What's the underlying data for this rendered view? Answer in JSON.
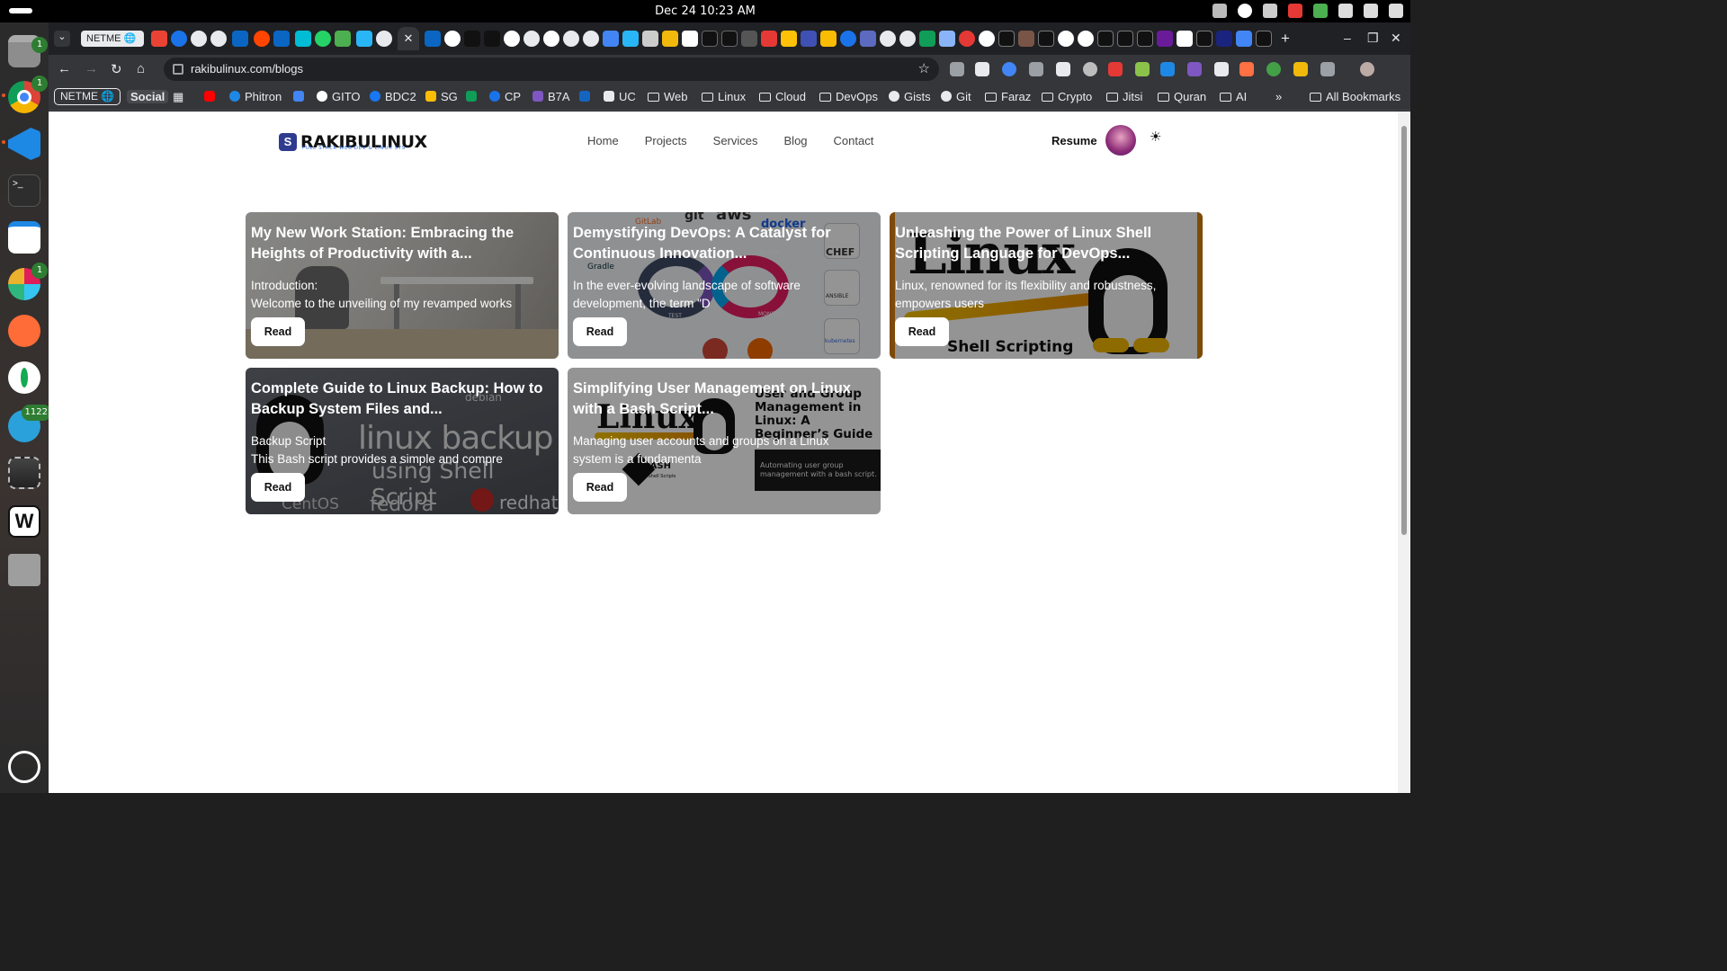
{
  "system": {
    "clock": "Dec 24  10:23 AM",
    "dock_badges": {
      "chrome_top": "1",
      "slack": "1",
      "telegram": "1122"
    }
  },
  "browser": {
    "tab_pill": "NETME 🌐",
    "url": "rakibulinux.com/blogs",
    "bookmarks": {
      "netme": "NETME 🌐",
      "items": [
        "Social",
        "Phitron",
        "GITO",
        "BDC2",
        "SG",
        "CP",
        "B7A",
        "UC",
        "Web",
        "Linux",
        "Cloud",
        "DevOps",
        "Gists",
        "Git",
        "Faraz",
        "Crypto",
        "Jitsi",
        "Quran",
        "AI"
      ],
      "all": "All Bookmarks"
    }
  },
  "site": {
    "logo_word": "RAKIBULINUX",
    "logo_sub": "FULL STACK WEB DEV & LINUX SYS",
    "nav": [
      "Home",
      "Projects",
      "Services",
      "Blog",
      "Contact"
    ],
    "resume": "Resume"
  },
  "posts": [
    {
      "title": "My New Work Station: Embracing the Heights of Productivity with a...",
      "excerpt_1": "Introduction:",
      "excerpt_2": "Welcome to the unveiling of my revamped works",
      "button": "Read"
    },
    {
      "title": "Demystifying DevOps: A Catalyst for Continuous Innovation...",
      "excerpt_1": "In the ever-evolving landscape of software",
      "excerpt_2": "development, the term \"D",
      "button": "Read"
    },
    {
      "title": "Unleashing the Power of Linux Shell Scripting Language for DevOps...",
      "excerpt_1": "Linux, renowned for its flexibility and robustness,",
      "excerpt_2": "empowers users",
      "button": "Read"
    },
    {
      "title": "Complete Guide to Linux Backup: How to Backup System Files and...",
      "excerpt_1": "Backup Script",
      "excerpt_2": "This Bash script provides a simple and compre",
      "button": "Read"
    },
    {
      "title": "Simplifying User Management on Linux with a Bash Script...",
      "excerpt_1": "Managing user accounts and groups on a Linux",
      "excerpt_2": "system is a fundamenta",
      "button": "Read"
    }
  ],
  "thumbnail_text": {
    "devops": [
      "git",
      "aws",
      "docker",
      "CHEF",
      "GitLab",
      "Gradle",
      "ANSIBLE",
      "kubernetes",
      "DEPLOY",
      "OPERATE",
      "MONITOR",
      "TEST",
      "PLAN",
      "BUILD"
    ],
    "shell": [
      "Linux",
      "Shell Scripting"
    ],
    "backup": [
      "debian",
      "linux backup",
      "using Shell Script",
      "CentOS",
      "fedora",
      "redhat"
    ],
    "usermgmt": [
      "Linux",
      "User and Group Management in Linux: A Beginner’s Guide",
      "Automating user group management with a bash script.",
      "BASH",
      "& Shell Scripts"
    ]
  },
  "colors": {
    "accent": "#2f3b8f",
    "dock_badge": "#2e7d32"
  }
}
